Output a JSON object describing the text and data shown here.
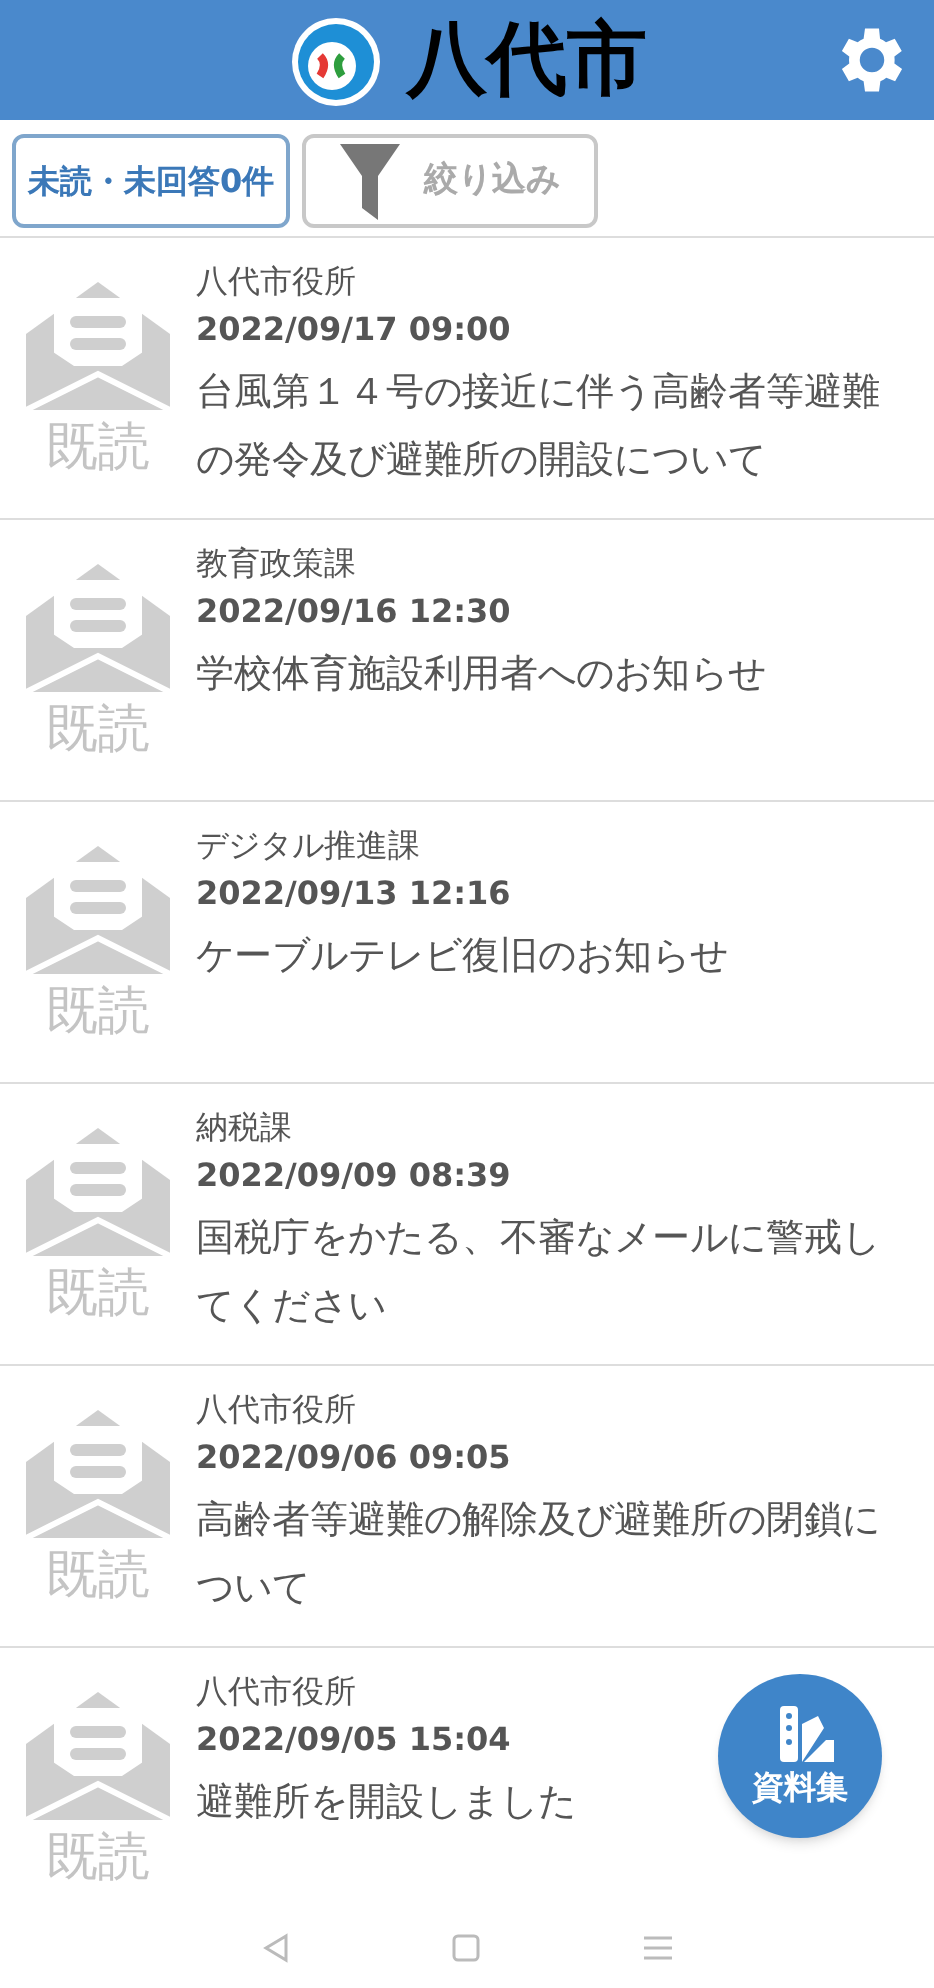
{
  "header": {
    "title": "八代市"
  },
  "filters": {
    "unread_button": "未読・未回答0件",
    "filter_button": "絞り込み"
  },
  "messages": [
    {
      "sender": "八代市役所",
      "date": "2022/09/17 09:00",
      "subject": "台風第１４号の接近に伴う高齢者等避難の発令及び避難所の開設について",
      "status": "既読"
    },
    {
      "sender": "教育政策課",
      "date": "2022/09/16 12:30",
      "subject": "学校体育施設利用者へのお知らせ",
      "status": "既読"
    },
    {
      "sender": "デジタル推進課",
      "date": "2022/09/13 12:16",
      "subject": "ケーブルテレビ復旧のお知らせ",
      "status": "既読"
    },
    {
      "sender": "納税課",
      "date": "2022/09/09 08:39",
      "subject": "国税庁をかたる、不審なメールに警戒してください",
      "status": "既読"
    },
    {
      "sender": "八代市役所",
      "date": "2022/09/06 09:05",
      "subject": "高齢者等避難の解除及び避難所の閉鎖について",
      "status": "既読"
    },
    {
      "sender": "八代市役所",
      "date": "2022/09/05 15:04",
      "subject": "避難所を開設しました",
      "status": "既読"
    }
  ],
  "fab": {
    "label": "資料集"
  }
}
